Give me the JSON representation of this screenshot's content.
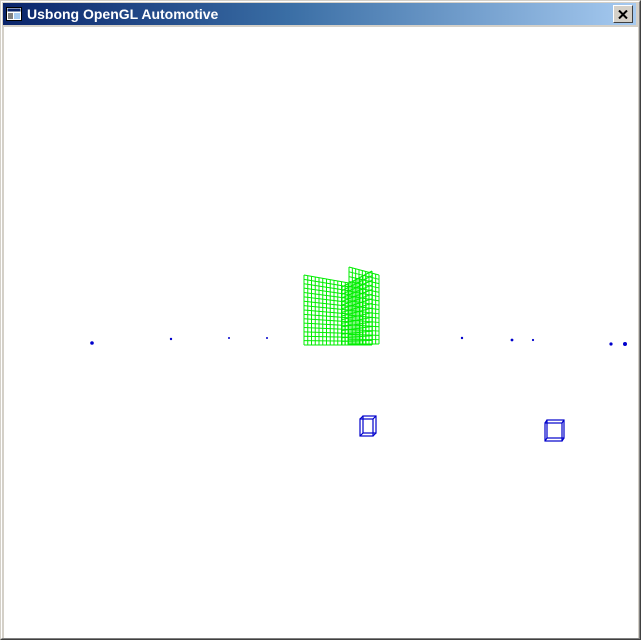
{
  "window": {
    "title": "Usbong OpenGL Automotive",
    "icon": "app-window-icon",
    "close_icon": "close-icon"
  },
  "viewport": {
    "background_color": "#ffffff",
    "building_color": "#00ee00",
    "object_color": "#0000cc"
  }
}
